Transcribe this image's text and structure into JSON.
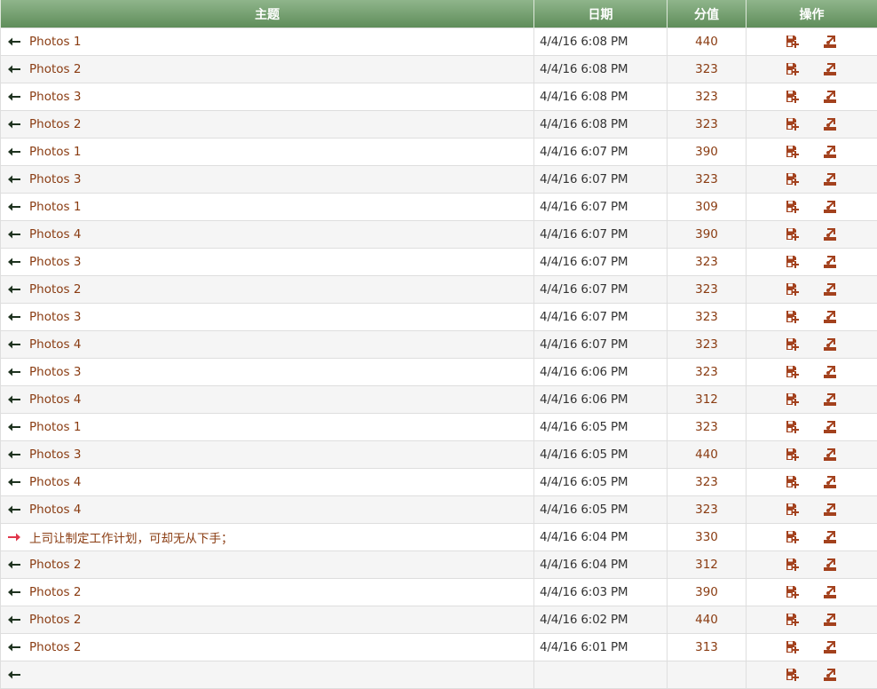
{
  "header": {
    "subject": "主题",
    "date": "日期",
    "score": "分值",
    "actions": "操作"
  },
  "colors": {
    "header_bg_top": "#8fb58b",
    "header_bg_bottom": "#5f8d5a",
    "link_text": "#8a3c12",
    "arrow_left": "#1f3320",
    "arrow_right": "#e0364b",
    "icon_color": "#a3411d"
  },
  "icons": {
    "row_direction_left": "arrow-left-icon",
    "row_direction_right": "arrow-right-icon",
    "action_1": "floppy-add-icon",
    "action_2": "user-export-icon"
  },
  "rows": [
    {
      "direction": "left",
      "subject": "Photos 1",
      "date": "4/4/16 6:08 PM",
      "score": "440"
    },
    {
      "direction": "left",
      "subject": "Photos 2",
      "date": "4/4/16 6:08 PM",
      "score": "323"
    },
    {
      "direction": "left",
      "subject": "Photos 3",
      "date": "4/4/16 6:08 PM",
      "score": "323"
    },
    {
      "direction": "left",
      "subject": "Photos 2",
      "date": "4/4/16 6:08 PM",
      "score": "323"
    },
    {
      "direction": "left",
      "subject": "Photos 1",
      "date": "4/4/16 6:07 PM",
      "score": "390"
    },
    {
      "direction": "left",
      "subject": "Photos 3",
      "date": "4/4/16 6:07 PM",
      "score": "323"
    },
    {
      "direction": "left",
      "subject": "Photos 1",
      "date": "4/4/16 6:07 PM",
      "score": "309"
    },
    {
      "direction": "left",
      "subject": "Photos 4",
      "date": "4/4/16 6:07 PM",
      "score": "390"
    },
    {
      "direction": "left",
      "subject": "Photos 3",
      "date": "4/4/16 6:07 PM",
      "score": "323"
    },
    {
      "direction": "left",
      "subject": "Photos 2",
      "date": "4/4/16 6:07 PM",
      "score": "323"
    },
    {
      "direction": "left",
      "subject": "Photos 3",
      "date": "4/4/16 6:07 PM",
      "score": "323"
    },
    {
      "direction": "left",
      "subject": "Photos 4",
      "date": "4/4/16 6:07 PM",
      "score": "323"
    },
    {
      "direction": "left",
      "subject": "Photos 3",
      "date": "4/4/16 6:06 PM",
      "score": "323"
    },
    {
      "direction": "left",
      "subject": "Photos 4",
      "date": "4/4/16 6:06 PM",
      "score": "312"
    },
    {
      "direction": "left",
      "subject": "Photos 1",
      "date": "4/4/16 6:05 PM",
      "score": "323"
    },
    {
      "direction": "left",
      "subject": "Photos 3",
      "date": "4/4/16 6:05 PM",
      "score": "440"
    },
    {
      "direction": "left",
      "subject": "Photos 4",
      "date": "4/4/16 6:05 PM",
      "score": "323"
    },
    {
      "direction": "left",
      "subject": "Photos 4",
      "date": "4/4/16 6:05 PM",
      "score": "323"
    },
    {
      "direction": "right",
      "subject": "上司让制定工作计划，可却无从下手；",
      "date": "4/4/16 6:04 PM",
      "score": "330"
    },
    {
      "direction": "left",
      "subject": "Photos 2",
      "date": "4/4/16 6:04 PM",
      "score": "312"
    },
    {
      "direction": "left",
      "subject": "Photos 2",
      "date": "4/4/16 6:03 PM",
      "score": "390"
    },
    {
      "direction": "left",
      "subject": "Photos 2",
      "date": "4/4/16 6:02 PM",
      "score": "440"
    },
    {
      "direction": "left",
      "subject": "Photos 2",
      "date": "4/4/16 6:01 PM",
      "score": "313"
    },
    {
      "direction": "left",
      "subject": "",
      "date": "",
      "score": ""
    }
  ]
}
